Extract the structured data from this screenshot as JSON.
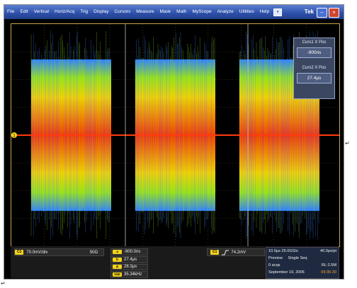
{
  "menu": {
    "items": [
      "File",
      "Edit",
      "Vertical",
      "Horiz/Acq",
      "Trig",
      "Display",
      "Cursors",
      "Measure",
      "Mask",
      "Math",
      "MyScope",
      "Analyze",
      "Utilities",
      "Help"
    ],
    "dropdown_icon": "chevron-down-icon"
  },
  "brand": "Tek",
  "window_buttons": {
    "minimize_icon": "minimize-icon",
    "close_icon": "close-icon"
  },
  "cursor_panel": {
    "cursor1_label": "Curs1 X Pos",
    "cursor1_value": "-900ns",
    "cursor2_label": "Curs2 X Pos",
    "cursor2_value": "27.4µs"
  },
  "channel": {
    "chip": "C1",
    "scale": "70.0mV/div",
    "impedance": "50Ω"
  },
  "measurements": [
    {
      "chip": "a",
      "value": "-900.0ns"
    },
    {
      "chip": "b",
      "value": "27.4µs"
    },
    {
      "chip": "Δ",
      "value": "28.3µs"
    },
    {
      "chip": "1/Δt",
      "value": "35.34kHz"
    }
  ],
  "trigger": {
    "chip": "C1",
    "slope_icon": "rising-edge-icon",
    "level": "74.2mV"
  },
  "acquisition": {
    "timebase": "10.0µs",
    "sample_rate": "25.0GS/s",
    "resolution": "40.0ps/pt",
    "mode": "Preview",
    "run_mode": "Single Seq",
    "acqs": "0 acqs",
    "record_length": "RL:2.5M",
    "date": "September 19, 2006",
    "time": "09:35:30"
  },
  "markers": {
    "channel_marker": "1",
    "pilcrow": "↵"
  },
  "colors": {
    "menubar": "#2c4fa8",
    "trace_core": "#ff2a00",
    "trace_mid": "#ffa800",
    "trace_edge": "#2f7fff",
    "graticule": "#c9a34a"
  },
  "waveform": {
    "bursts": 3,
    "description_values": {
      "burst_count": 3
    }
  }
}
